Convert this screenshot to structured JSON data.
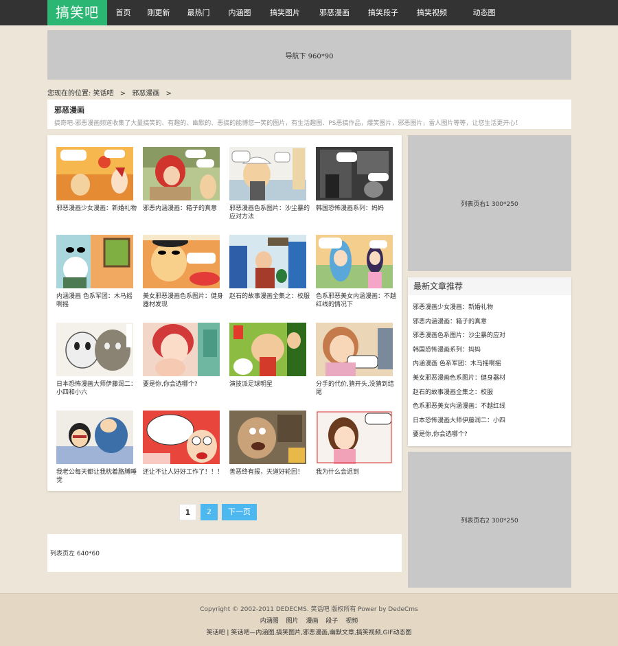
{
  "logo": "搞笑吧",
  "nav": [
    "首页",
    "刚更新",
    "最热门",
    "内涵图",
    "搞笑图片",
    "邪恶漫画",
    "搞笑段子",
    "搞笑视频",
    "动态图"
  ],
  "ads": {
    "top": "导航下 960*90",
    "right1": "列表页右1 300*250",
    "right2": "列表页右2 300*250",
    "left": "列表页左 640*60"
  },
  "breadcrumb": {
    "label": "您现在的位置:",
    "home": "笑话吧",
    "sep1": ">",
    "category": "邪恶漫画",
    "sep2": ">"
  },
  "category": {
    "title": "邪恶漫画",
    "description": "搞奇吧-邪恶漫画频道收集了大量搞笑的、有趣的、幽默的、恶搞的能博您一笑的图片，有生活趣图、PS恶搞作品，爆笑图片，邪恶图片，雷人图片等等，让您生活更开心！"
  },
  "items": [
    {
      "title": "邪恶漫画少女漫画：新婚礼物",
      "icon": "comic-thumbnail"
    },
    {
      "title": "邪恶内涵漫画：箱子的真意",
      "icon": "comic-thumbnail"
    },
    {
      "title": "邪恶漫画色系图片：沙尘暴的应对方法",
      "icon": "comic-thumbnail"
    },
    {
      "title": "韩国恐怖漫画系列：妈妈",
      "icon": "comic-thumbnail"
    },
    {
      "title": "内涵漫画 色系军团：木马摇啊摇",
      "icon": "comic-thumbnail"
    },
    {
      "title": "美女邪恶漫画色系图片：健身器材发现",
      "icon": "comic-thumbnail"
    },
    {
      "title": "赵石的故事漫画全集之：校服",
      "icon": "comic-thumbnail"
    },
    {
      "title": "色系邪恶美女内涵漫画：不越红线的情况下",
      "icon": "comic-thumbnail"
    },
    {
      "title": "日本恐怖漫画大师伊藤润二：小四和小六",
      "icon": "comic-thumbnail"
    },
    {
      "title": "要是你,你会选哪个?",
      "icon": "comic-thumbnail"
    },
    {
      "title": "演技派足球明星",
      "icon": "comic-thumbnail"
    },
    {
      "title": "分手的代价,猜开头,没猜到结尾",
      "icon": "comic-thumbnail"
    },
    {
      "title": "我老公每天都让我枕着胳膊睡觉",
      "icon": "comic-thumbnail"
    },
    {
      "title": "还让不让人好好工作了！！！",
      "icon": "comic-thumbnail"
    },
    {
      "title": "善恶终有报，天道好轮回！",
      "icon": "comic-thumbnail"
    },
    {
      "title": "我为什么会迟到",
      "icon": "comic-thumbnail"
    }
  ],
  "pagination": {
    "current": "1",
    "next_num": "2",
    "next_label": "下一页"
  },
  "recent": {
    "title": "最新文章推荐",
    "items": [
      "邪恶漫画少女漫画：新婚礼物",
      "邪恶内涵漫画：箱子的真意",
      "邪恶漫画色系图片：沙尘暴的应对",
      "韩国恐怖漫画系列：妈妈",
      "内涵漫画 色系军团：木马摇啊摇",
      "美女邪恶漫画色系图片：健身器材",
      "赵石的故事漫画全集之：校服",
      "色系邪恶美女内涵漫画：不越红线",
      "日本恐怖漫画大师伊藤润二：小四",
      "要是你,你会选哪个?"
    ]
  },
  "footer": {
    "copyright": "Copyright © 2002-2011 DEDECMS. 笑话吧 版权所有   Power by DedeCms",
    "links": [
      "内涵图",
      "图片",
      "漫画",
      "段子",
      "视频"
    ],
    "bottom": "笑话吧  |  笑话吧—内涵图,搞笑图片,邪恶漫画,幽默文章,搞笑视频,GIF动态图"
  },
  "colors": {
    "accent": "#2bb673",
    "topbar": "#333333",
    "background": "#ede5d8",
    "pager_blue": "#4db8f0",
    "ad_gray": "#c8c8c8"
  }
}
